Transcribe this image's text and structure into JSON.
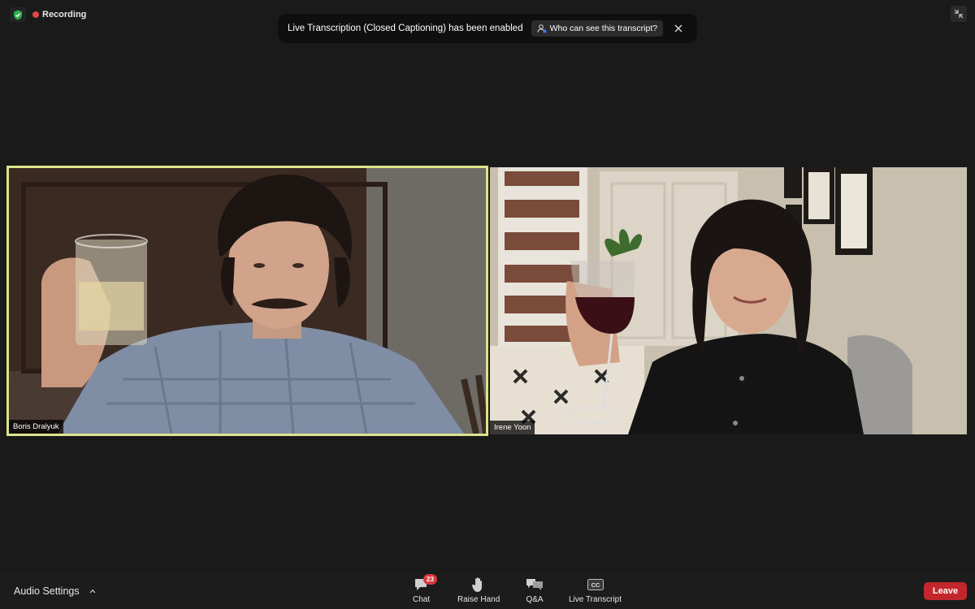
{
  "status": {
    "recording_label": "Recording",
    "shield_icon": "shield-check-icon"
  },
  "banner": {
    "message": "Live Transcription (Closed Captioning) has been enabled",
    "who_button_label": "Who can see this transcript?"
  },
  "participants": [
    {
      "name": "Boris Dralyuk",
      "active_speaker": true
    },
    {
      "name": "Irene Yoon",
      "active_speaker": false
    }
  ],
  "toolbar": {
    "audio_settings_label": "Audio Settings",
    "chat_label": "Chat",
    "chat_badge": "23",
    "raise_hand_label": "Raise Hand",
    "qa_label": "Q&A",
    "live_transcript_label": "Live Transcript",
    "cc_text": "CC",
    "leave_label": "Leave"
  },
  "colors": {
    "active_speaker_border": "#dce38c",
    "recording_dot": "#e0454a",
    "leave_button": "#c3272b",
    "badge": "#d83a3a"
  }
}
